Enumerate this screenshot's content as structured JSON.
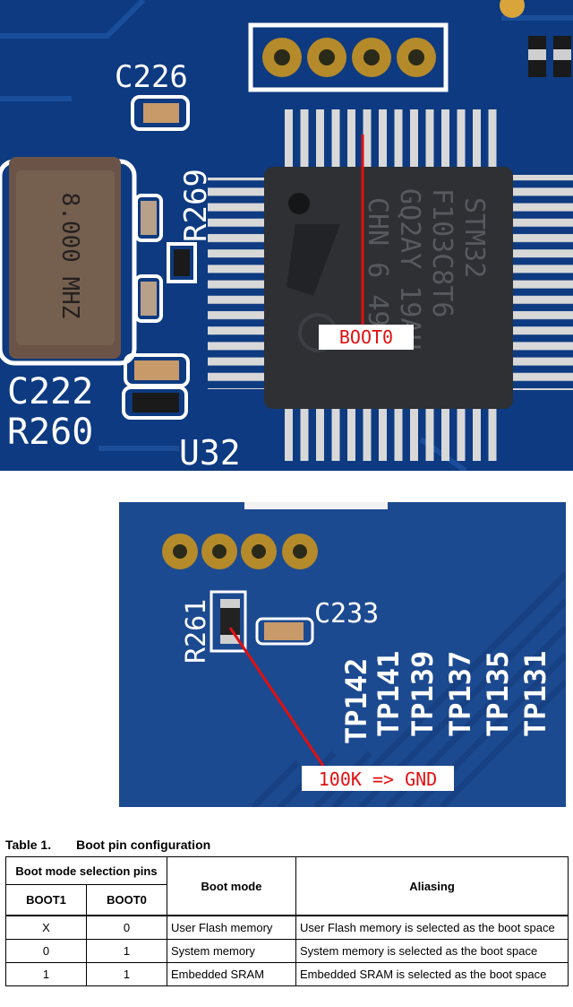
{
  "photo1": {
    "labels": {
      "c226": "C226",
      "r269": "R269",
      "c222": "C222",
      "r260": "R260",
      "u32": "U32",
      "crystal": "8.000 MHZ",
      "chip_line1": "STM32",
      "chip_line2": "F103C8T6",
      "chip_line3": "GQ2AY 19AU",
      "chip_line4": "CHN 6 49"
    },
    "callout": "BOOT0",
    "colors": {
      "board": "#0d3a80",
      "chip": "#2e3033",
      "callout_text": "#e01010",
      "line": "#e01010"
    }
  },
  "photo2": {
    "labels": {
      "r261": "R261",
      "c233": "C233",
      "tp142": "TP142",
      "tp141": "TP141",
      "tp139": "TP139",
      "tp137": "TP137",
      "tp135": "TP135",
      "tp131": "TP131"
    },
    "callout": "100K => GND"
  },
  "table": {
    "number": "Table 1.",
    "title": "Boot pin configuration",
    "headers": {
      "group": "Boot mode selection pins",
      "boot1": "BOOT1",
      "boot0": "BOOT0",
      "mode": "Boot mode",
      "aliasing": "Aliasing"
    },
    "rows": [
      {
        "boot1": "X",
        "boot0": "0",
        "mode": "User Flash memory",
        "aliasing": "User Flash memory is selected as the boot space"
      },
      {
        "boot1": "0",
        "boot0": "1",
        "mode": "System memory",
        "aliasing": "System memory is selected as the boot space"
      },
      {
        "boot1": "1",
        "boot0": "1",
        "mode": "Embedded SRAM",
        "aliasing": "Embedded SRAM is selected as the boot space"
      }
    ]
  }
}
